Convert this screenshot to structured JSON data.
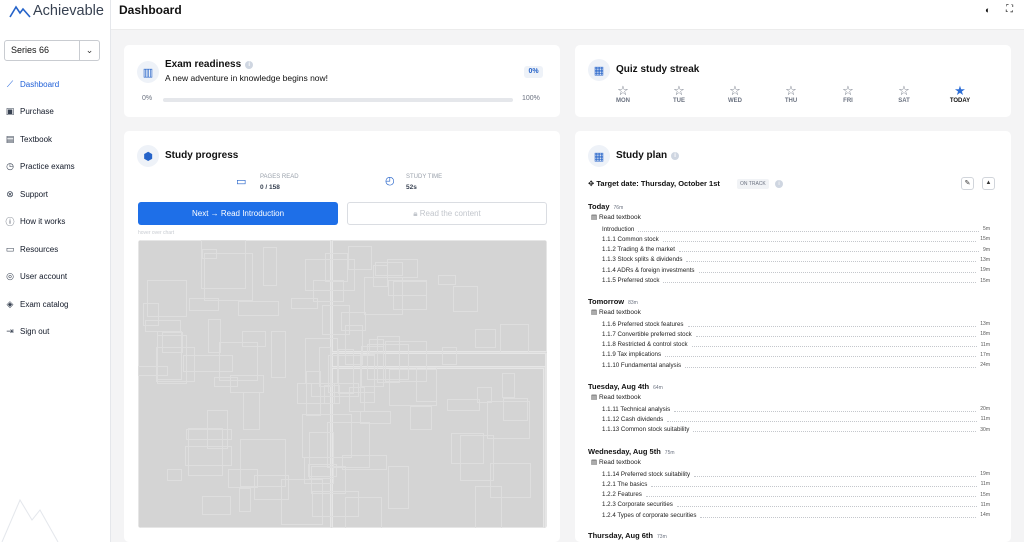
{
  "app": {
    "name": "Achievable"
  },
  "sidebar": {
    "exam_select": "Series 66",
    "items": [
      {
        "label": "Dashboard",
        "icon": "chart-line-icon",
        "glyph": "⟋",
        "active": true
      },
      {
        "label": "Purchase",
        "icon": "cart-icon",
        "glyph": "▣"
      },
      {
        "label": "Textbook",
        "icon": "book-icon",
        "glyph": "▤"
      },
      {
        "label": "Practice exams",
        "icon": "clipboard-icon",
        "glyph": "◷"
      },
      {
        "label": "Support",
        "icon": "lifebuoy-icon",
        "glyph": "⊗"
      },
      {
        "label": "How it works",
        "icon": "info-icon",
        "glyph": "ⓘ"
      },
      {
        "label": "Resources",
        "icon": "document-icon",
        "glyph": "▭"
      },
      {
        "label": "User account",
        "icon": "user-icon",
        "glyph": "◎"
      },
      {
        "label": "Exam catalog",
        "icon": "stack-icon",
        "glyph": "◈"
      },
      {
        "label": "Sign out",
        "icon": "sign-out-icon",
        "glyph": "⇥"
      }
    ]
  },
  "header": {
    "title": "Dashboard"
  },
  "readiness": {
    "title": "Exam readiness",
    "subtitle": "A new adventure in knowledge begins now!",
    "badge": "0%",
    "min": "0%",
    "max": "100%",
    "progress": 0
  },
  "streak": {
    "title": "Quiz study streak",
    "days": [
      {
        "label": "MON",
        "done": false
      },
      {
        "label": "TUE",
        "done": false
      },
      {
        "label": "WED",
        "done": false
      },
      {
        "label": "THU",
        "done": false
      },
      {
        "label": "FRI",
        "done": false
      },
      {
        "label": "SAT",
        "done": false
      },
      {
        "label": "TODAY",
        "done": true
      }
    ]
  },
  "progress": {
    "title": "Study progress",
    "pages_label": "PAGES READ",
    "pages_value": "0 / 158",
    "time_label": "STUDY TIME",
    "time_value": "52s",
    "next_button": "Next → Read Introduction",
    "read_button": "Read the content",
    "hover_hint": "hover over chart"
  },
  "plan": {
    "title": "Study plan",
    "target": "Target date: Thursday, October 1st",
    "status": "ON TRACK",
    "read_textbook": "Read textbook",
    "days": [
      {
        "name": "Today",
        "mins": "76m",
        "tasks": [
          {
            "label": "Introduction",
            "time": "5m"
          },
          {
            "label": "1.1.1 Common stock",
            "time": "15m"
          },
          {
            "label": "1.1.2 Trading & the market",
            "time": "9m"
          },
          {
            "label": "1.1.3 Stock splits & dividends",
            "time": "13m"
          },
          {
            "label": "1.1.4 ADRs & foreign investments",
            "time": "19m"
          },
          {
            "label": "1.1.5 Preferred stock",
            "time": "15m"
          }
        ]
      },
      {
        "name": "Tomorrow",
        "mins": "83m",
        "tasks": [
          {
            "label": "1.1.6 Preferred stock features",
            "time": "13m"
          },
          {
            "label": "1.1.7 Convertible preferred stock",
            "time": "18m"
          },
          {
            "label": "1.1.8 Restricted & control stock",
            "time": "11m"
          },
          {
            "label": "1.1.9 Tax implications",
            "time": "17m"
          },
          {
            "label": "1.1.10 Fundamental analysis",
            "time": "24m"
          }
        ]
      },
      {
        "name": "Tuesday, Aug 4th",
        "mins": "64m",
        "tasks": [
          {
            "label": "1.1.11 Technical analysis",
            "time": "20m"
          },
          {
            "label": "1.1.12 Cash dividends",
            "time": "11m"
          },
          {
            "label": "1.1.13 Common stock suitability",
            "time": "30m"
          }
        ]
      },
      {
        "name": "Wednesday, Aug 5th",
        "mins": "75m",
        "tasks": [
          {
            "label": "1.1.14 Preferred stock suitability",
            "time": "19m"
          },
          {
            "label": "1.2.1 The basics",
            "time": "11m"
          },
          {
            "label": "1.2.2 Features",
            "time": "15m"
          },
          {
            "label": "1.2.3 Corporate securities",
            "time": "11m"
          },
          {
            "label": "1.2.4 Types of corporate securities",
            "time": "14m"
          }
        ]
      },
      {
        "name": "Thursday, Aug 6th",
        "mins": "73m",
        "tasks": []
      }
    ]
  },
  "colors": {
    "accent": "#1e6fe8",
    "star_active": "#2f6fd6",
    "tile": "#d4d4d4"
  }
}
